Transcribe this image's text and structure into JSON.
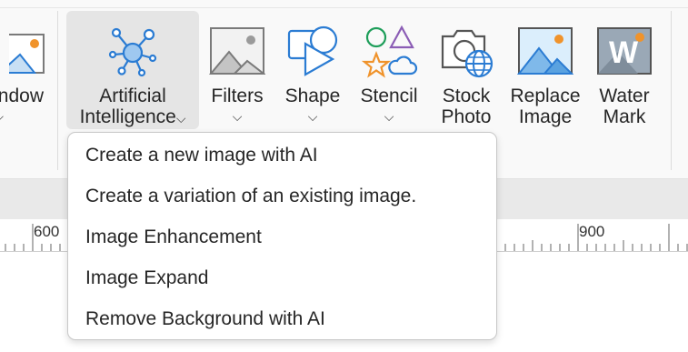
{
  "ribbon": {
    "partial_window_label": "ndow",
    "buttons": [
      {
        "id": "ai",
        "line1": "Artificial",
        "line2": "Intelligence",
        "icon": "network-nodes-icon"
      },
      {
        "id": "filters",
        "line1": "Filters",
        "icon": "image-filter-icon"
      },
      {
        "id": "shape",
        "line1": "Shape",
        "icon": "shape-icon"
      },
      {
        "id": "stencil",
        "line1": "Stencil",
        "icon": "stencil-shapes-icon"
      },
      {
        "id": "stock",
        "line1": "Stock",
        "line2": "Photo",
        "icon": "stock-photo-icon"
      },
      {
        "id": "replace",
        "line1": "Replace",
        "line2": "Image",
        "icon": "replace-image-icon"
      },
      {
        "id": "watermark",
        "line1": "Water",
        "line2": "Mark",
        "icon": "watermark-icon"
      }
    ]
  },
  "ruler": {
    "left_number": "600",
    "right_number": "900"
  },
  "ai_menu": {
    "items": [
      "Create a new image with AI",
      "Create a variation of an existing image.",
      "Image Enhancement",
      "Image Expand",
      "Remove Background with AI"
    ]
  },
  "colors": {
    "accent_blue": "#2b7cd3",
    "icon_gray": "#7a7a7a",
    "orange": "#f0932b",
    "green": "#1e9e5a",
    "purple": "#8b5db5"
  }
}
